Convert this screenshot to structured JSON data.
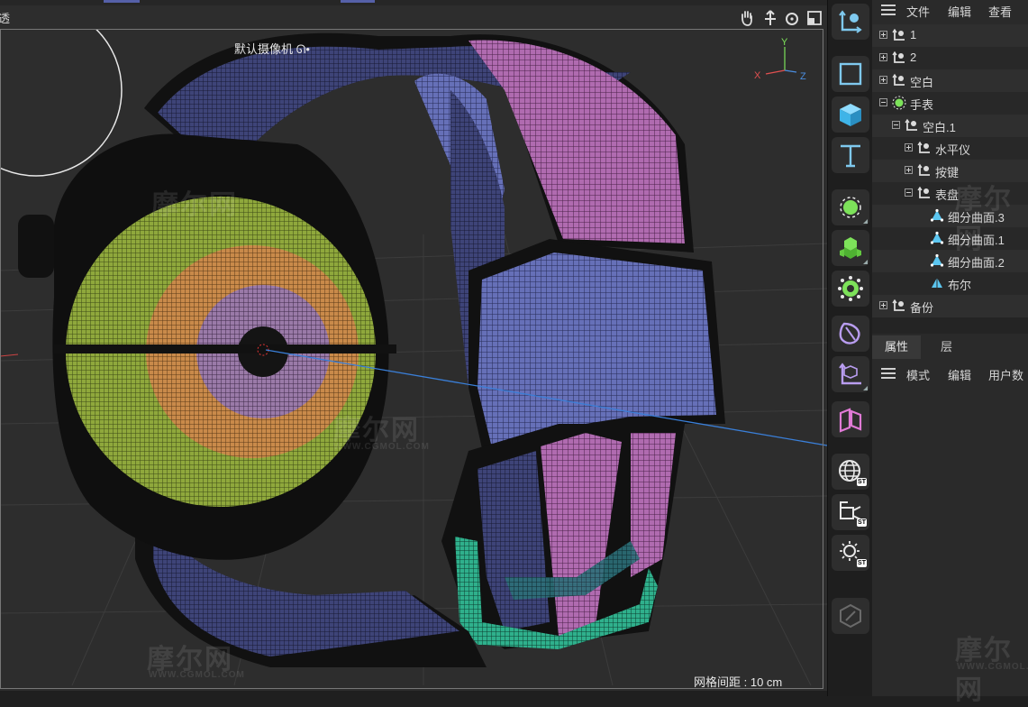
{
  "viewport": {
    "menu_edge": "透",
    "camera": "默认摄像机 ᘏ•",
    "axis_labels": {
      "x": "X",
      "y": "Y",
      "z": "Z"
    },
    "nav_icons": [
      "pan-hand-icon",
      "move-arrows-icon",
      "rotate-icon",
      "maximize-view-icon"
    ],
    "grid_spacing": "网格间距 : 10 cm",
    "watermark_cn": "摩尔网",
    "watermark_en": "WWW.CGMOL.COM"
  },
  "palette": {
    "tools": [
      {
        "name": "coordinate-system-tool-icon",
        "color": "#7fc9ee"
      },
      {
        "name": "rectangle-select-icon",
        "color": "#7fc9ee"
      },
      {
        "name": "cube-primitive-icon",
        "color": "#5cc6f0"
      },
      {
        "name": "text-tool-icon",
        "color": "#7fc9ee"
      },
      {
        "name": "spline-pen-icon",
        "color": "#7de25a"
      },
      {
        "name": "cloner-icon",
        "color": "#7de25a"
      },
      {
        "name": "deformer-gear-icon",
        "color": "#7de25a"
      },
      {
        "name": "bend-deformer-icon",
        "color": "#b99df0"
      },
      {
        "name": "transform-axes-icon",
        "color": "#b99df0"
      },
      {
        "name": "field-icon",
        "color": "#e07ad6"
      },
      {
        "name": "globe-st-icon",
        "color": "#e8e8e8"
      },
      {
        "name": "camera-st-icon",
        "color": "#e8e8e8"
      },
      {
        "name": "light-st-icon",
        "color": "#e8e8e8"
      },
      {
        "name": "tag-disabled-icon",
        "color": "#6a6a6a"
      }
    ],
    "st_badge": "ST"
  },
  "object_manager": {
    "menu": [
      "文件",
      "编辑",
      "查看"
    ],
    "items": [
      {
        "label": "1",
        "depth": 0,
        "expander": "plus",
        "icon": "null-object-icon"
      },
      {
        "label": "2",
        "depth": 0,
        "expander": "plus",
        "icon": "null-object-icon"
      },
      {
        "label": "空白",
        "depth": 0,
        "expander": "plus",
        "icon": "null-object-icon"
      },
      {
        "label": "手表",
        "depth": 0,
        "expander": "minus",
        "icon": "connector-object-icon"
      },
      {
        "label": "空白.1",
        "depth": 1,
        "expander": "minus",
        "icon": "null-object-icon"
      },
      {
        "label": "水平仪",
        "depth": 2,
        "expander": "plus",
        "icon": "null-object-icon"
      },
      {
        "label": "按键",
        "depth": 2,
        "expander": "plus",
        "icon": "null-object-icon"
      },
      {
        "label": "表盘",
        "depth": 2,
        "expander": "minus",
        "icon": "null-object-icon"
      },
      {
        "label": "细分曲面.3",
        "depth": 3,
        "expander": "none",
        "icon": "subdivision-surface-icon"
      },
      {
        "label": "细分曲面.1",
        "depth": 3,
        "expander": "none",
        "icon": "subdivision-surface-icon"
      },
      {
        "label": "细分曲面.2",
        "depth": 3,
        "expander": "none",
        "icon": "subdivision-surface-icon"
      },
      {
        "label": "布尔",
        "depth": 3,
        "expander": "none",
        "icon": "boolean-icon"
      },
      {
        "label": "备份",
        "depth": 0,
        "expander": "plus",
        "icon": "null-object-icon"
      }
    ]
  },
  "attributes": {
    "tabs": [
      "属性",
      "层"
    ],
    "menu": [
      "模式",
      "编辑",
      "用户数"
    ]
  }
}
